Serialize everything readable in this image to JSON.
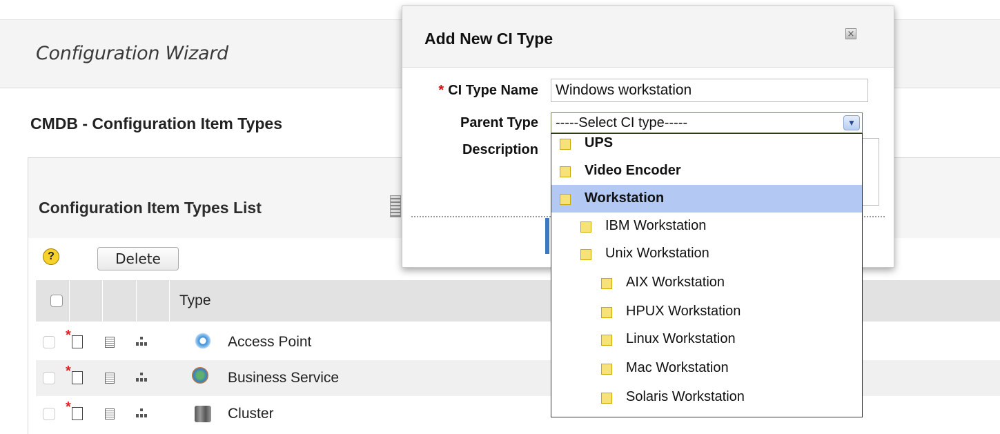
{
  "wizard": {
    "title": "Configuration Wizard"
  },
  "page": {
    "title": "CMDB -  Configuration Item Types"
  },
  "list_panel": {
    "title": "Configuration Item Types List",
    "delete_label": "Delete",
    "help_glyph": "?",
    "column_type": "Type",
    "rows": [
      {
        "label": "Access Point",
        "icon": "access-point-icon",
        "color": "#3b8fd4"
      },
      {
        "label": "Business Service",
        "icon": "business-service-icon",
        "color": "#c97a2a"
      },
      {
        "label": "Cluster",
        "icon": "cluster-icon",
        "color": "#777777"
      }
    ]
  },
  "modal": {
    "title": "Add New CI Type",
    "close_glyph": "×",
    "required_mark": "*",
    "name_label": "CI Type Name",
    "name_value": "Windows workstation",
    "parent_label": "Parent Type",
    "parent_value": "-----Select CI type-----",
    "description_label": "Description"
  },
  "dropdown": {
    "items": [
      {
        "label": "UPS",
        "level": 0,
        "bold": true,
        "selected": false
      },
      {
        "label": "Video Encoder",
        "level": 0,
        "bold": true,
        "selected": false
      },
      {
        "label": "Workstation",
        "level": 0,
        "bold": true,
        "selected": true
      },
      {
        "label": "IBM Workstation",
        "level": 1,
        "bold": false,
        "selected": false
      },
      {
        "label": "Unix Workstation",
        "level": 1,
        "bold": false,
        "selected": false
      },
      {
        "label": "AIX Workstation",
        "level": 2,
        "bold": false,
        "selected": false
      },
      {
        "label": "HPUX Workstation",
        "level": 2,
        "bold": false,
        "selected": false
      },
      {
        "label": "Linux Workstation",
        "level": 2,
        "bold": false,
        "selected": false
      },
      {
        "label": "Mac Workstation",
        "level": 2,
        "bold": false,
        "selected": false
      },
      {
        "label": "Solaris Workstation",
        "level": 2,
        "bold": false,
        "selected": false
      }
    ]
  },
  "colors": {
    "accent": "#b3c8f2",
    "required": "#d01010",
    "folder": "#f7e27a"
  }
}
